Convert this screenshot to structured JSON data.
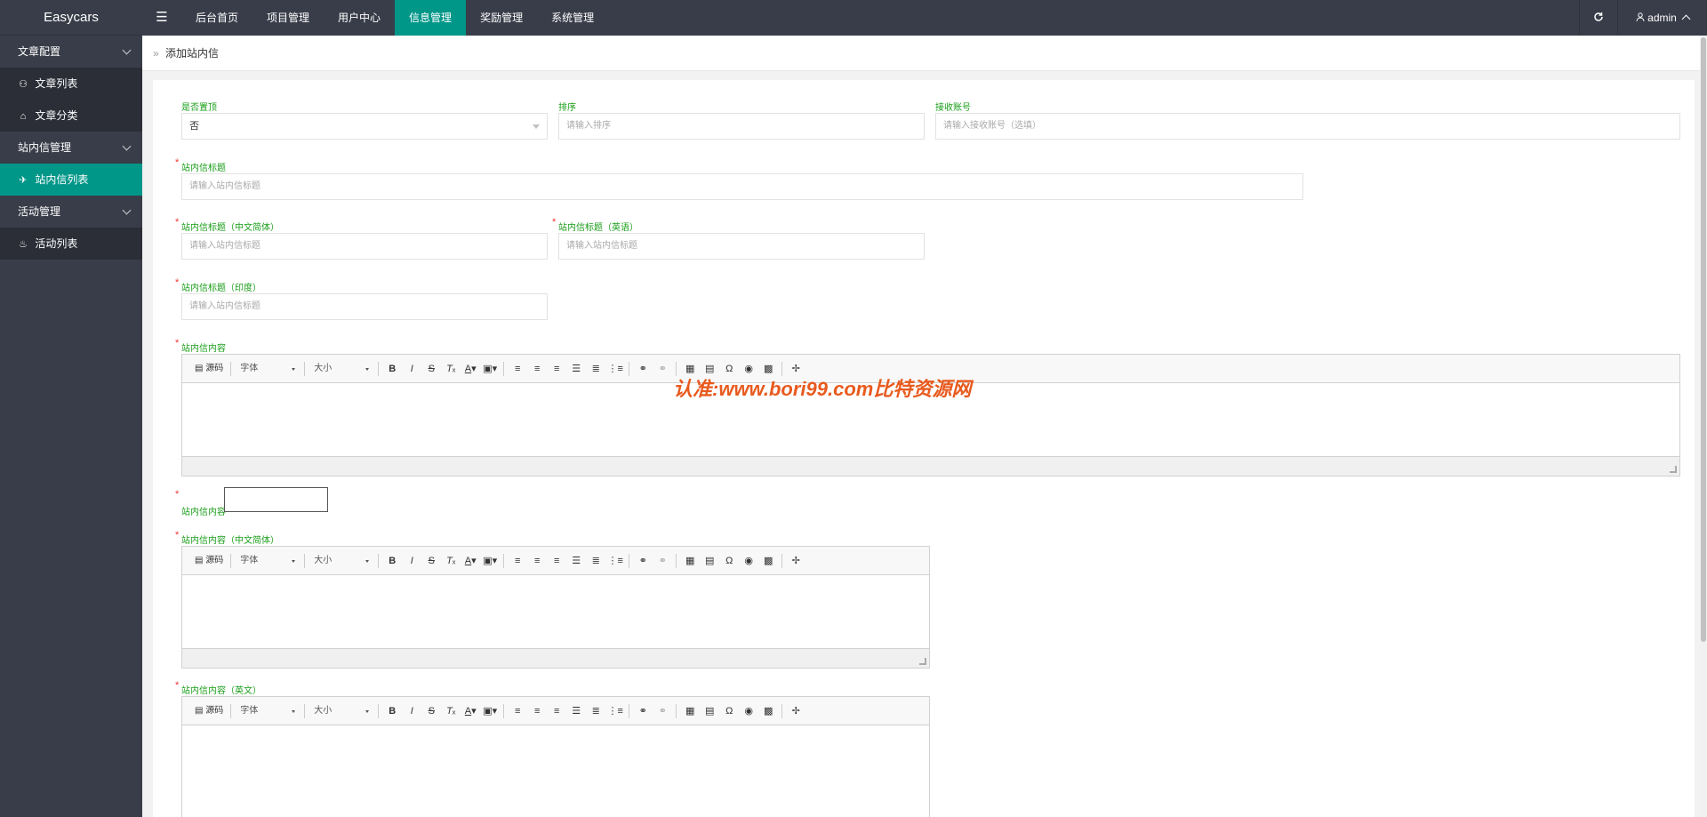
{
  "app": {
    "logo": "Easycars",
    "menu_icon": "☰",
    "refresh_icon": "refresh-icon",
    "user": "admin"
  },
  "topnav": [
    {
      "label": "后台首页",
      "active": false
    },
    {
      "label": "项目管理",
      "active": false
    },
    {
      "label": "用户中心",
      "active": false
    },
    {
      "label": "信息管理",
      "active": true
    },
    {
      "label": "奖励管理",
      "active": false
    },
    {
      "label": "系统管理",
      "active": false
    }
  ],
  "sidebar": {
    "groups": [
      {
        "label": "文章配置",
        "items": [
          {
            "label": "文章列表",
            "icon": "⚇"
          },
          {
            "label": "文章分类",
            "icon": "⌂"
          }
        ]
      },
      {
        "label": "站内信管理",
        "items": [
          {
            "label": "站内信列表",
            "icon": "✈",
            "active": true
          }
        ]
      },
      {
        "label": "活动管理",
        "items": [
          {
            "label": "活动列表",
            "icon": "♨"
          }
        ]
      }
    ]
  },
  "breadcrumb": {
    "sep": "»",
    "title": "添加站内信"
  },
  "form": {
    "is_top": {
      "label": "是否置顶",
      "value": "否"
    },
    "sort": {
      "label": "排序",
      "placeholder": "请输入排序"
    },
    "receiver": {
      "label": "接收账号",
      "placeholder": "请输入接收账号（选填）"
    },
    "title": {
      "label": "站内信标题",
      "placeholder": "请输入站内信标题"
    },
    "title_zh": {
      "label": "站内信标题（中文简体）",
      "placeholder": "请输入站内信标题"
    },
    "title_en": {
      "label": "站内信标题（英语）",
      "placeholder": "请输入站内信标题"
    },
    "title_in": {
      "label": "站内信标题（印度）",
      "placeholder": "请输入站内信标题"
    },
    "content": {
      "label": "站内信内容"
    },
    "content_raw": {
      "label": "站内信内容"
    },
    "content_zh": {
      "label": "站内信内容（中文简体）"
    },
    "content_en": {
      "label": "站内信内容（英文）"
    }
  },
  "editor": {
    "source_label": "源码",
    "font_label": "字体",
    "size_label": "大小"
  },
  "watermark": "认准:www.bori99.com比特资源网"
}
